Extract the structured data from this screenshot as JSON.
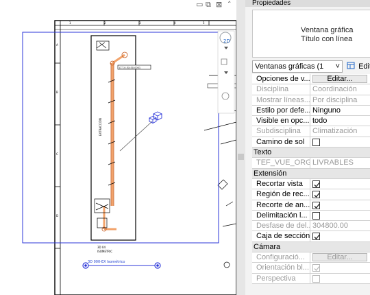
{
  "window": {
    "minimize_icon": "minimize-icon",
    "restore_icon": "restore-icon",
    "close_icon": "close-icon",
    "collapse_icon": "chevron-up-icon"
  },
  "view": {
    "view_tag_label": "3D 000-EX Isométrico",
    "sheet_label": "LT-T-0-EX-S0-0001"
  },
  "properties": {
    "header": "Propiedades",
    "type_name": "Ventana gráfica",
    "type_subname": "Título con línea",
    "selector_value": "Ventanas gráficas (1",
    "edit_type_label": "Editar",
    "rows": [
      {
        "name": "Opciones de v...",
        "kind": "button",
        "value": "Editar...",
        "disabled": false
      },
      {
        "name": "Disciplina",
        "kind": "text",
        "value": "Coordinación",
        "disabled": true
      },
      {
        "name": "Mostrar líneas...",
        "kind": "text",
        "value": "Por disciplina",
        "disabled": true
      },
      {
        "name": "Estilo por defe...",
        "kind": "text",
        "value": "Ninguno",
        "disabled": false
      },
      {
        "name": "Visible en opc...",
        "kind": "text",
        "value": "todo",
        "disabled": false
      },
      {
        "name": "Subdisciplina",
        "kind": "text",
        "value": "Climatización",
        "disabled": true
      },
      {
        "name": "Camino de sol",
        "kind": "check",
        "checked": false,
        "disabled": false
      },
      {
        "name": "Texto",
        "kind": "section"
      },
      {
        "name": "TEF_VUE_ORG...",
        "kind": "text",
        "value": "LIVRABLES",
        "disabled": true
      },
      {
        "name": "Extensión",
        "kind": "section"
      },
      {
        "name": "Recortar vista",
        "kind": "check",
        "checked": true,
        "disabled": false
      },
      {
        "name": "Región de rec...",
        "kind": "check",
        "checked": true,
        "disabled": false
      },
      {
        "name": "Recorte de an...",
        "kind": "check",
        "checked": true,
        "disabled": false
      },
      {
        "name": "Delimitación l...",
        "kind": "check",
        "checked": false,
        "disabled": false
      },
      {
        "name": "Desfase de del...",
        "kind": "text",
        "value": "304800.00",
        "disabled": true
      },
      {
        "name": "Caja de sección",
        "kind": "check",
        "checked": true,
        "disabled": false
      },
      {
        "name": "Cámara",
        "kind": "section"
      },
      {
        "name": "Configuració...",
        "kind": "button",
        "value": "Editar...",
        "disabled": true
      },
      {
        "name": "Orientación bl...",
        "kind": "check",
        "checked": true,
        "disabled": true
      },
      {
        "name": "Perspectiva",
        "kind": "check",
        "checked": false,
        "disabled": true
      }
    ]
  },
  "colors": {
    "selection_blue": "#2b36d9",
    "pipe_orange": "#f2a36b",
    "text_disabled": "#9a9a9a"
  }
}
